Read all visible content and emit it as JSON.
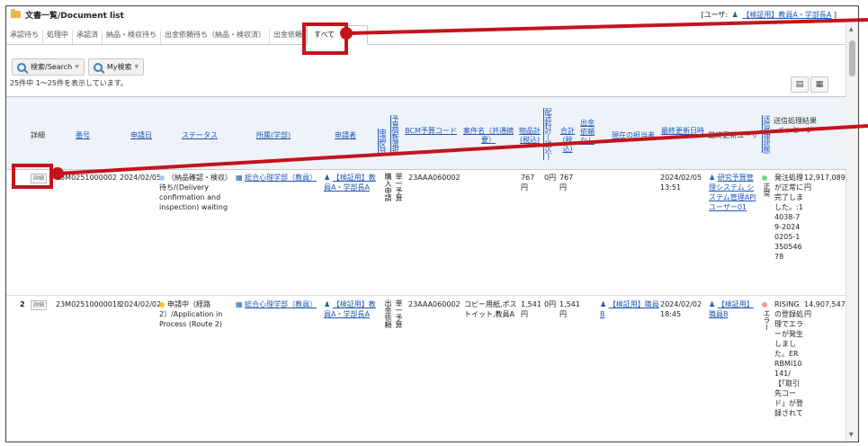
{
  "window": {
    "title": "文書一覧/Document list",
    "user_prefix": "[ユーザ:",
    "user_name": "【検証用】教員A・学部長A",
    "user_suffix": "]"
  },
  "tabs": [
    "承認待ち",
    "処理中",
    "承認済",
    "納品・検収待ち",
    "出金依頼待ち（納品・検収済）",
    "出金依頼",
    "すべて"
  ],
  "toolbar": {
    "search_label": "検索/Search",
    "my_search_label": "My検索"
  },
  "result_count": "25件中 1〜25件を表示しています。",
  "columns": {
    "detail": "詳細",
    "number": "番号",
    "apply_date": "申請日",
    "status": "ステータス",
    "dept": "所属(学部)",
    "applicant": "申請者",
    "apply_category": "申請区分",
    "budget_count_selected": "予算個数選択",
    "bcm_code": "BCM予算コード",
    "item_name": "案件名（共通摘要）",
    "item_total": "物品計(税込)",
    "shipping_total": "配送料計(税込)",
    "grand_total": "合計(税込)",
    "no_payment": "出金依頼なし",
    "current_handler": "現在の担当者",
    "last_update": "最終更新日時",
    "last_update_user": "最終更新ユーザ",
    "send_status": "送信処理状態",
    "send_result": "送信処理結果メッセージ"
  },
  "rows": [
    {
      "detail_label": "詳細",
      "number": "23M0251000002",
      "apply_date": "2024/02/05",
      "status": "（納品確認・検収）待ち/(Delivery confirmation and inspection) waiting",
      "dept": "総合心理学部（教員）",
      "applicant": "【検証用】教員A・学部長A",
      "apply_category": "購入申請",
      "budget_count": "単一予算",
      "bcm_code": "23AAA060002",
      "item_name": "",
      "item_total": "767円",
      "shipping_total": "0円",
      "grand_total": "767円",
      "handler": "",
      "last_update": "2024/02/05 13:51",
      "last_update_user": "研究予算管理システム システム管理APIユーザー01",
      "send_status": "正常",
      "send_result": "発注処理が正常に完了しました。:14038-79-20240205-135054678",
      "amount": "12,917,089円",
      "status_color": "#a6c8ef",
      "send_color": "#7fd27f"
    },
    {
      "index": "2",
      "detail_label": "詳細",
      "number": "23M02510000018",
      "apply_date": "2024/02/02",
      "status": "申請中（経路2）/Application in Process (Route 2)",
      "dept": "総合心理学部（教員）",
      "applicant": "【検証用】教員A・学部長A",
      "apply_category": "出金依頼",
      "budget_count": "単一予算",
      "bcm_code": "23AAA060002",
      "item_name": "コピー用紙,ポストイット,教員A",
      "item_total": "1,541円",
      "shipping_total": "0円",
      "grand_total": "1,541円",
      "handler": "【検証用】職員B",
      "last_update": "2024/02/02 18:45",
      "last_update_user": "【検証用】職員B",
      "send_status": "エラー",
      "send_result": "RISINGの登録処理でエラーが発生しました。ERRBMI10141/【「取引先コード」が登録されて",
      "amount": "14,907,547円",
      "status_color": "#f0c23b",
      "send_color": "#f29a9a"
    }
  ],
  "colors": {
    "annotation": "#c4141d",
    "link": "#1f57b5",
    "header_bg": "#eef3fa"
  }
}
